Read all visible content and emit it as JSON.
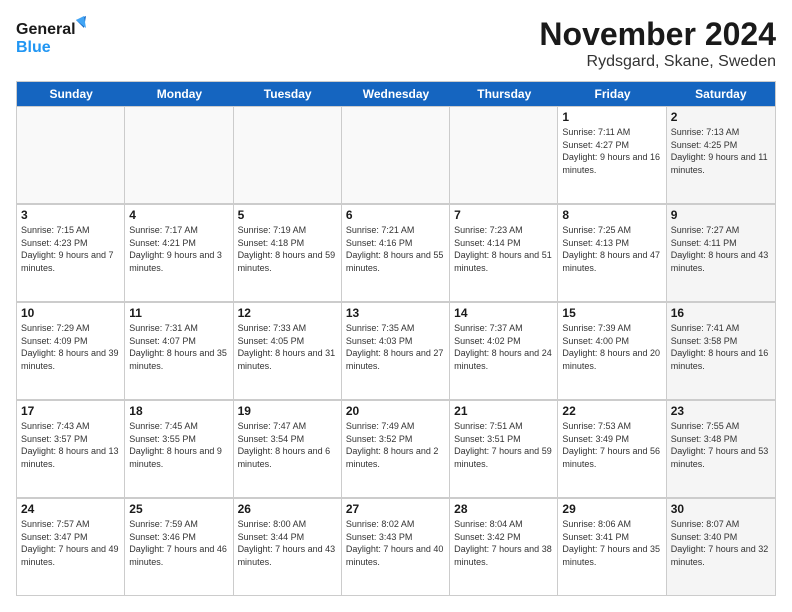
{
  "logo": {
    "line1": "General",
    "line2": "Blue"
  },
  "title": "November 2024",
  "location": "Rydsgard, Skane, Sweden",
  "days_of_week": [
    "Sunday",
    "Monday",
    "Tuesday",
    "Wednesday",
    "Thursday",
    "Friday",
    "Saturday"
  ],
  "weeks": [
    [
      {
        "day": "",
        "info": ""
      },
      {
        "day": "",
        "info": ""
      },
      {
        "day": "",
        "info": ""
      },
      {
        "day": "",
        "info": ""
      },
      {
        "day": "",
        "info": ""
      },
      {
        "day": "1",
        "info": "Sunrise: 7:11 AM\nSunset: 4:27 PM\nDaylight: 9 hours and 16 minutes."
      },
      {
        "day": "2",
        "info": "Sunrise: 7:13 AM\nSunset: 4:25 PM\nDaylight: 9 hours and 11 minutes."
      }
    ],
    [
      {
        "day": "3",
        "info": "Sunrise: 7:15 AM\nSunset: 4:23 PM\nDaylight: 9 hours and 7 minutes."
      },
      {
        "day": "4",
        "info": "Sunrise: 7:17 AM\nSunset: 4:21 PM\nDaylight: 9 hours and 3 minutes."
      },
      {
        "day": "5",
        "info": "Sunrise: 7:19 AM\nSunset: 4:18 PM\nDaylight: 8 hours and 59 minutes."
      },
      {
        "day": "6",
        "info": "Sunrise: 7:21 AM\nSunset: 4:16 PM\nDaylight: 8 hours and 55 minutes."
      },
      {
        "day": "7",
        "info": "Sunrise: 7:23 AM\nSunset: 4:14 PM\nDaylight: 8 hours and 51 minutes."
      },
      {
        "day": "8",
        "info": "Sunrise: 7:25 AM\nSunset: 4:13 PM\nDaylight: 8 hours and 47 minutes."
      },
      {
        "day": "9",
        "info": "Sunrise: 7:27 AM\nSunset: 4:11 PM\nDaylight: 8 hours and 43 minutes."
      }
    ],
    [
      {
        "day": "10",
        "info": "Sunrise: 7:29 AM\nSunset: 4:09 PM\nDaylight: 8 hours and 39 minutes."
      },
      {
        "day": "11",
        "info": "Sunrise: 7:31 AM\nSunset: 4:07 PM\nDaylight: 8 hours and 35 minutes."
      },
      {
        "day": "12",
        "info": "Sunrise: 7:33 AM\nSunset: 4:05 PM\nDaylight: 8 hours and 31 minutes."
      },
      {
        "day": "13",
        "info": "Sunrise: 7:35 AM\nSunset: 4:03 PM\nDaylight: 8 hours and 27 minutes."
      },
      {
        "day": "14",
        "info": "Sunrise: 7:37 AM\nSunset: 4:02 PM\nDaylight: 8 hours and 24 minutes."
      },
      {
        "day": "15",
        "info": "Sunrise: 7:39 AM\nSunset: 4:00 PM\nDaylight: 8 hours and 20 minutes."
      },
      {
        "day": "16",
        "info": "Sunrise: 7:41 AM\nSunset: 3:58 PM\nDaylight: 8 hours and 16 minutes."
      }
    ],
    [
      {
        "day": "17",
        "info": "Sunrise: 7:43 AM\nSunset: 3:57 PM\nDaylight: 8 hours and 13 minutes."
      },
      {
        "day": "18",
        "info": "Sunrise: 7:45 AM\nSunset: 3:55 PM\nDaylight: 8 hours and 9 minutes."
      },
      {
        "day": "19",
        "info": "Sunrise: 7:47 AM\nSunset: 3:54 PM\nDaylight: 8 hours and 6 minutes."
      },
      {
        "day": "20",
        "info": "Sunrise: 7:49 AM\nSunset: 3:52 PM\nDaylight: 8 hours and 2 minutes."
      },
      {
        "day": "21",
        "info": "Sunrise: 7:51 AM\nSunset: 3:51 PM\nDaylight: 7 hours and 59 minutes."
      },
      {
        "day": "22",
        "info": "Sunrise: 7:53 AM\nSunset: 3:49 PM\nDaylight: 7 hours and 56 minutes."
      },
      {
        "day": "23",
        "info": "Sunrise: 7:55 AM\nSunset: 3:48 PM\nDaylight: 7 hours and 53 minutes."
      }
    ],
    [
      {
        "day": "24",
        "info": "Sunrise: 7:57 AM\nSunset: 3:47 PM\nDaylight: 7 hours and 49 minutes."
      },
      {
        "day": "25",
        "info": "Sunrise: 7:59 AM\nSunset: 3:46 PM\nDaylight: 7 hours and 46 minutes."
      },
      {
        "day": "26",
        "info": "Sunrise: 8:00 AM\nSunset: 3:44 PM\nDaylight: 7 hours and 43 minutes."
      },
      {
        "day": "27",
        "info": "Sunrise: 8:02 AM\nSunset: 3:43 PM\nDaylight: 7 hours and 40 minutes."
      },
      {
        "day": "28",
        "info": "Sunrise: 8:04 AM\nSunset: 3:42 PM\nDaylight: 7 hours and 38 minutes."
      },
      {
        "day": "29",
        "info": "Sunrise: 8:06 AM\nSunset: 3:41 PM\nDaylight: 7 hours and 35 minutes."
      },
      {
        "day": "30",
        "info": "Sunrise: 8:07 AM\nSunset: 3:40 PM\nDaylight: 7 hours and 32 minutes."
      }
    ]
  ]
}
